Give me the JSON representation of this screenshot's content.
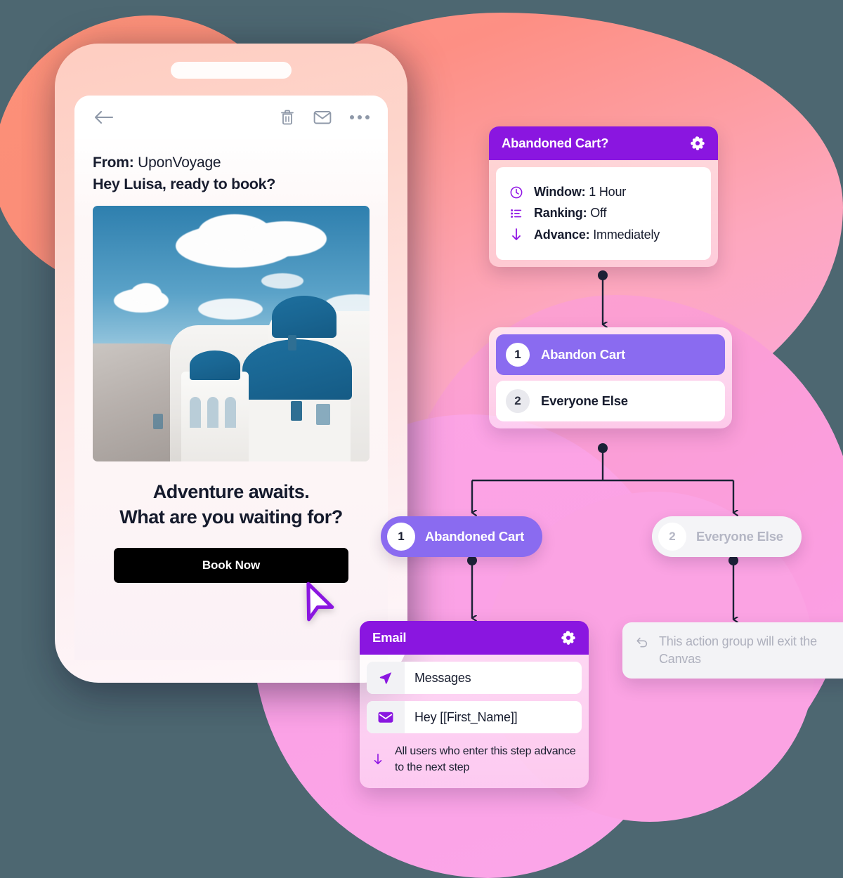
{
  "background": {
    "page_bg": "#4d6771",
    "blobs": [
      "#fc9179",
      "#fd9484",
      "#fba3e3",
      "#fba6e8"
    ]
  },
  "phone": {
    "mail_toolbar": {
      "back": "back-arrow-icon",
      "trash": "trash-icon",
      "envelope": "envelope-icon",
      "more": "more-options-icon"
    },
    "email": {
      "from_label": "From:",
      "from_value": "UponVoyage",
      "subject": "Hey Luisa, ready to book?",
      "hero_alt": "Santorini blue domes",
      "headline_line1": "Adventure awaits.",
      "headline_line2": "What are you waiting for?",
      "cta_label": "Book Now"
    }
  },
  "canvas": {
    "entry_card": {
      "title": "Abandoned Cart?",
      "gear": "gear-icon",
      "rows": [
        {
          "icon": "clock-icon",
          "label": "Window:",
          "value": "1 Hour"
        },
        {
          "icon": "list-icon",
          "label": "Ranking:",
          "value": "Off"
        },
        {
          "icon": "arrow-down-icon",
          "label": "Advance:",
          "value": "Immediately"
        }
      ]
    },
    "branch_card": {
      "items": [
        {
          "number": "1",
          "label": "Abandon Cart",
          "selected": true
        },
        {
          "number": "2",
          "label": "Everyone Else",
          "selected": false
        }
      ]
    },
    "pills": [
      {
        "number": "1",
        "label": "Abandoned Cart",
        "state": "active"
      },
      {
        "number": "2",
        "label": "Everyone Else",
        "state": "muted"
      }
    ],
    "email_card": {
      "title": "Email",
      "gear": "gear-icon",
      "fields": [
        {
          "icon": "send-icon",
          "value": "Messages"
        },
        {
          "icon": "envelope-icon",
          "value": "Hey [[First_Name]]"
        }
      ],
      "note_icon": "arrow-down-icon",
      "note": "All users who enter this step advance to the next step"
    },
    "exit_note": {
      "icon": "undo-arrow-icon",
      "text": "This action group will exit the Canvas"
    }
  },
  "colors": {
    "purple_header": "#8a16e0",
    "purple_accent": "#8f14e4",
    "lavender": "#8a6bf0",
    "connector": "#1b2236",
    "cursor_outline": "#8a16e0"
  }
}
